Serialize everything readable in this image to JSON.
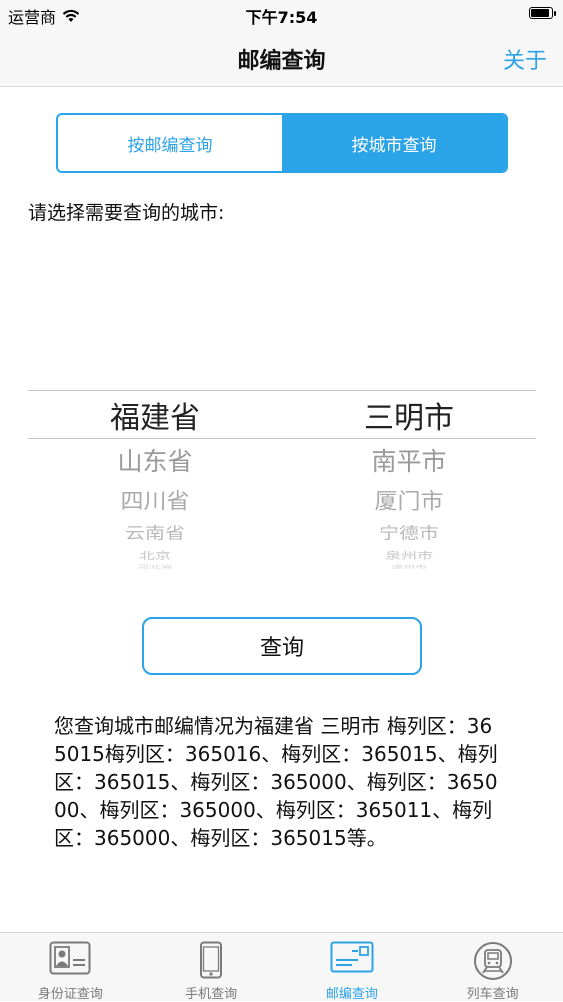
{
  "status_bar": {
    "carrier": "运营商",
    "time": "下午7:54"
  },
  "nav": {
    "title": "邮编查询",
    "about_label": "关于"
  },
  "segment": {
    "by_zip": "按邮编查询",
    "by_city": "按城市查询",
    "active": "by_city"
  },
  "prompt": "请选择需要查询的城市:",
  "picker": {
    "provinces": [
      "福建省",
      "山东省",
      "四川省",
      "云南省",
      "北京",
      "河北省"
    ],
    "cities": [
      "三明市",
      "南平市",
      "厦门市",
      "宁德市",
      "泉州市",
      "漳州市"
    ]
  },
  "query_button": "查询",
  "result": "您查询城市邮编情况为福建省 三明市 梅列区：365015梅列区：365016、梅列区：365015、梅列区：365015、梅列区：365000、梅列区：365000、梅列区：365000、梅列区：365011、梅列区：365000、梅列区：365015等。",
  "tabs": [
    {
      "label": "身份证查询",
      "icon": "id-card-icon"
    },
    {
      "label": "手机查询",
      "icon": "phone-icon"
    },
    {
      "label": "邮编查询",
      "icon": "envelope-icon"
    },
    {
      "label": "列车查询",
      "icon": "train-icon"
    }
  ],
  "active_tab": 2,
  "colors": {
    "accent": "#2aa3e8",
    "inactive_tab": "#7a7a7a"
  }
}
